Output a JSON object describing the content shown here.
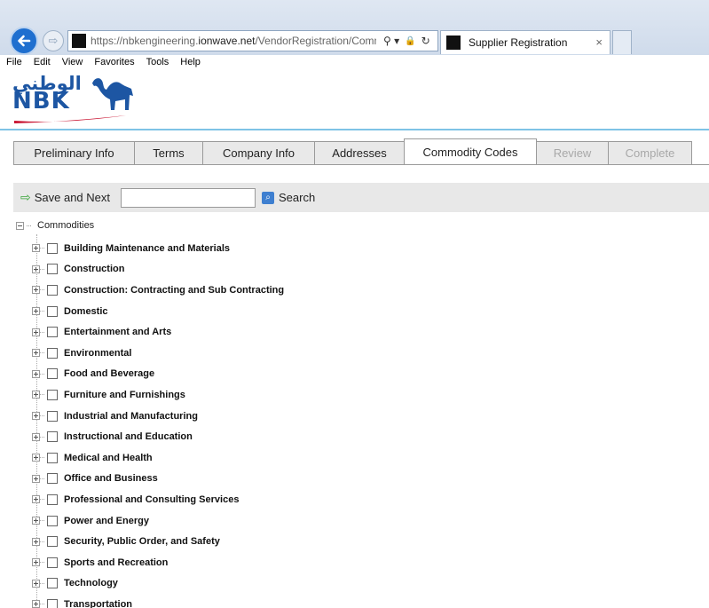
{
  "browser": {
    "url_prefix": "https://nbkengineering.",
    "url_domain": "ionwave.net",
    "url_path": "/VendorRegistration/Commo",
    "tab_title": "Supplier Registration",
    "tab_close": "×",
    "forward_glyph": "⇨",
    "search_glyph": "⚲ ▾",
    "lock_glyph": "🔒",
    "refresh_glyph": "↻"
  },
  "menu": [
    "File",
    "Edit",
    "View",
    "Favorites",
    "Tools",
    "Help"
  ],
  "logo": {
    "arabic_text": "الوطني",
    "brand_text": "NBK"
  },
  "wizard_tabs": [
    {
      "label": "Preliminary Info",
      "state": "normal"
    },
    {
      "label": "Terms",
      "state": "normal"
    },
    {
      "label": "Company Info",
      "state": "normal"
    },
    {
      "label": "Addresses",
      "state": "normal"
    },
    {
      "label": "Commodity Codes",
      "state": "active"
    },
    {
      "label": "Review",
      "state": "disabled"
    },
    {
      "label": "Complete",
      "state": "disabled"
    }
  ],
  "toolbar": {
    "save_label": "Save and Next",
    "save_arrow": "⇨",
    "search_value": "",
    "search_label": "Search",
    "search_glyph": "⌕"
  },
  "tree": {
    "root_label": "Commodities",
    "items": [
      "Building Maintenance and Materials",
      "Construction",
      "Construction: Contracting and Sub Contracting",
      "Domestic",
      "Entertainment and Arts",
      "Environmental",
      "Food and Beverage",
      "Furniture and Furnishings",
      "Industrial and Manufacturing",
      "Instructional and Education",
      "Medical and Health",
      "Office and Business",
      "Professional and Consulting Services",
      "Power and Energy",
      "Security, Public Order, and Safety",
      "Sports and Recreation",
      "Technology",
      "Transportation"
    ]
  },
  "colors": {
    "brand_blue": "#1d56a3",
    "accent_red": "#c8102e",
    "header_rule": "#7ec3e6",
    "toolbar_bg": "#e8e8e8",
    "save_arrow": "#3aa53a"
  }
}
